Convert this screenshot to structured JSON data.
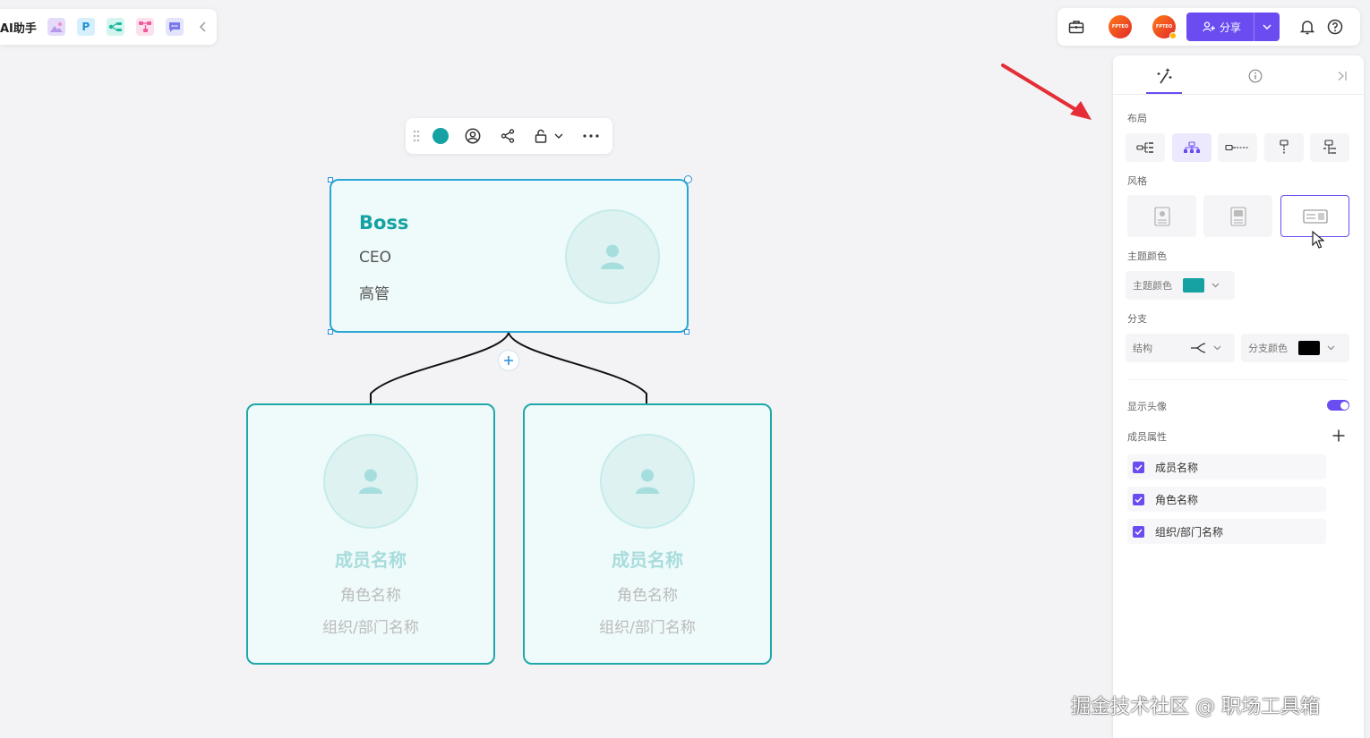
{
  "top_left_toolbar": {
    "ai_label": "AI助手",
    "apps": [
      {
        "icon": "image-ai-icon",
        "color": "#d9c8f5"
      },
      {
        "icon": "p-icon",
        "text": "P",
        "color": "#2fa7e6"
      },
      {
        "icon": "mindmap-icon",
        "color": "#27c2b0"
      },
      {
        "icon": "flow-icon",
        "color": "#f06aa8"
      },
      {
        "icon": "chat-icon",
        "color": "#8c8cf0"
      }
    ]
  },
  "top_right_toolbar": {
    "avatar_text": "FPTEO",
    "share_label": "分享"
  },
  "org_chart": {
    "root": {
      "name": "Boss",
      "role": "CEO",
      "dept": "高管"
    },
    "children": [
      {
        "name": "成员名称",
        "role": "角色名称",
        "dept": "组织/部门名称"
      },
      {
        "name": "成员名称",
        "role": "角色名称",
        "dept": "组织/部门名称"
      }
    ],
    "theme_color": "#16a2a2"
  },
  "panel": {
    "layout_label": "布局",
    "style_label": "风格",
    "theme_color_label": "主题颜色",
    "theme_color_select": "主题颜色",
    "theme_color_value": "#16a2a2",
    "branch_label": "分支",
    "structure_label": "结构",
    "branch_color_label": "分支颜色",
    "branch_color_value": "#000000",
    "show_avatar_label": "显示头像",
    "show_avatar_on": true,
    "member_attr_label": "成员属性",
    "attributes": [
      "成员名称",
      "角色名称",
      "组织/部门名称"
    ]
  },
  "accent_color": "#6a4cf0",
  "watermark": "掘金技术社区 @ 职场工具箱"
}
